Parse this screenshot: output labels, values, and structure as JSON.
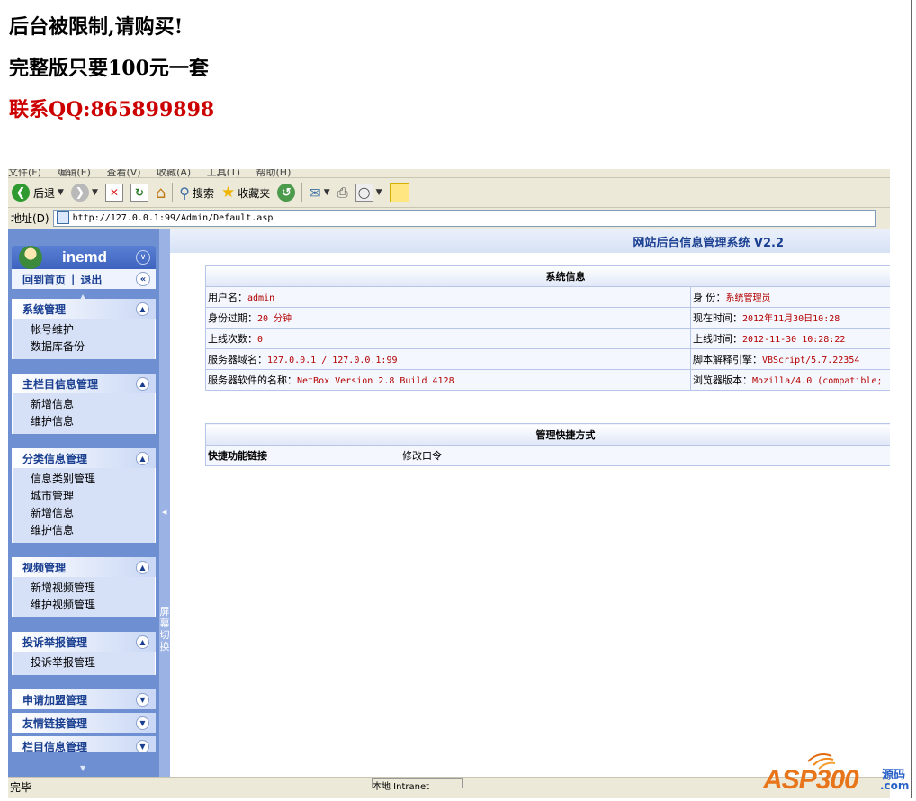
{
  "notice": {
    "line1": "后台被限制,请购买!",
    "line2": "完整版只要100元一套",
    "line3": "联系QQ:865899898"
  },
  "browser": {
    "menu": [
      "文件(F)",
      "编辑(E)",
      "查看(V)",
      "收藏(A)",
      "工具(T)",
      "帮助(H)"
    ],
    "toolbar": {
      "back_label": "后退",
      "search_label": "搜索",
      "favorites_label": "收藏夹"
    },
    "address": {
      "label": "地址(D)",
      "url": "http://127.0.0.1:99/Admin/Default.asp"
    },
    "status": {
      "text": "完毕",
      "pane": "本地 Intranet"
    }
  },
  "sidebar": {
    "brand": "inemd",
    "home": "回到首页",
    "separator": "|",
    "logout": "退出",
    "sections": [
      {
        "title": "系统管理",
        "items": [
          "帐号维护",
          "数据库备份"
        ]
      },
      {
        "title": "主栏目信息管理",
        "items": [
          "新增信息",
          "维护信息"
        ]
      },
      {
        "title": "分类信息管理",
        "items": [
          "信息类别管理",
          "城市管理",
          "新增信息",
          "维护信息"
        ]
      },
      {
        "title": "视频管理",
        "items": [
          "新增视频管理",
          "维护视频管理"
        ]
      },
      {
        "title": "投诉举报管理",
        "items": [
          "投诉举报管理"
        ]
      },
      {
        "title": "申请加盟管理",
        "items": []
      },
      {
        "title": "友情链接管理",
        "items": []
      },
      {
        "title": "栏目信息管理",
        "items": []
      }
    ],
    "splitter_text": "屏幕切换"
  },
  "main": {
    "title": "网站后台信息管理系统 V2.2",
    "sysinfo": {
      "header": "系统信息",
      "rows": [
        {
          "l_label": "用户名：",
          "l_value": "admin",
          "r_label": "身 份：",
          "r_value": "系统管理员"
        },
        {
          "l_label": "身份过期：",
          "l_value": "20 分钟",
          "r_label": "现在时间：",
          "r_value": "2012年11月30日10:28"
        },
        {
          "l_label": "上线次数：",
          "l_value": "0",
          "r_label": "上线时间：",
          "r_value": "2012-11-30 10:28:22"
        },
        {
          "l_label": "服务器域名：",
          "l_value": "127.0.0.1 / 127.0.0.1:99",
          "r_label": "脚本解释引擎：",
          "r_value": "VBScript/5.7.22354"
        },
        {
          "l_label": "服务器软件的名称：",
          "l_value": "NetBox Version 2.8 Build 4128",
          "r_label": "浏览器版本：",
          "r_value": "Mozilla/4.0 (compatible;"
        }
      ]
    },
    "shortcuts": {
      "header": "管理快捷方式",
      "label": "快捷功能链接",
      "link": "修改口令"
    }
  },
  "watermark": {
    "brand": "ASP300",
    "sub": "源码",
    "domain": ".com"
  }
}
